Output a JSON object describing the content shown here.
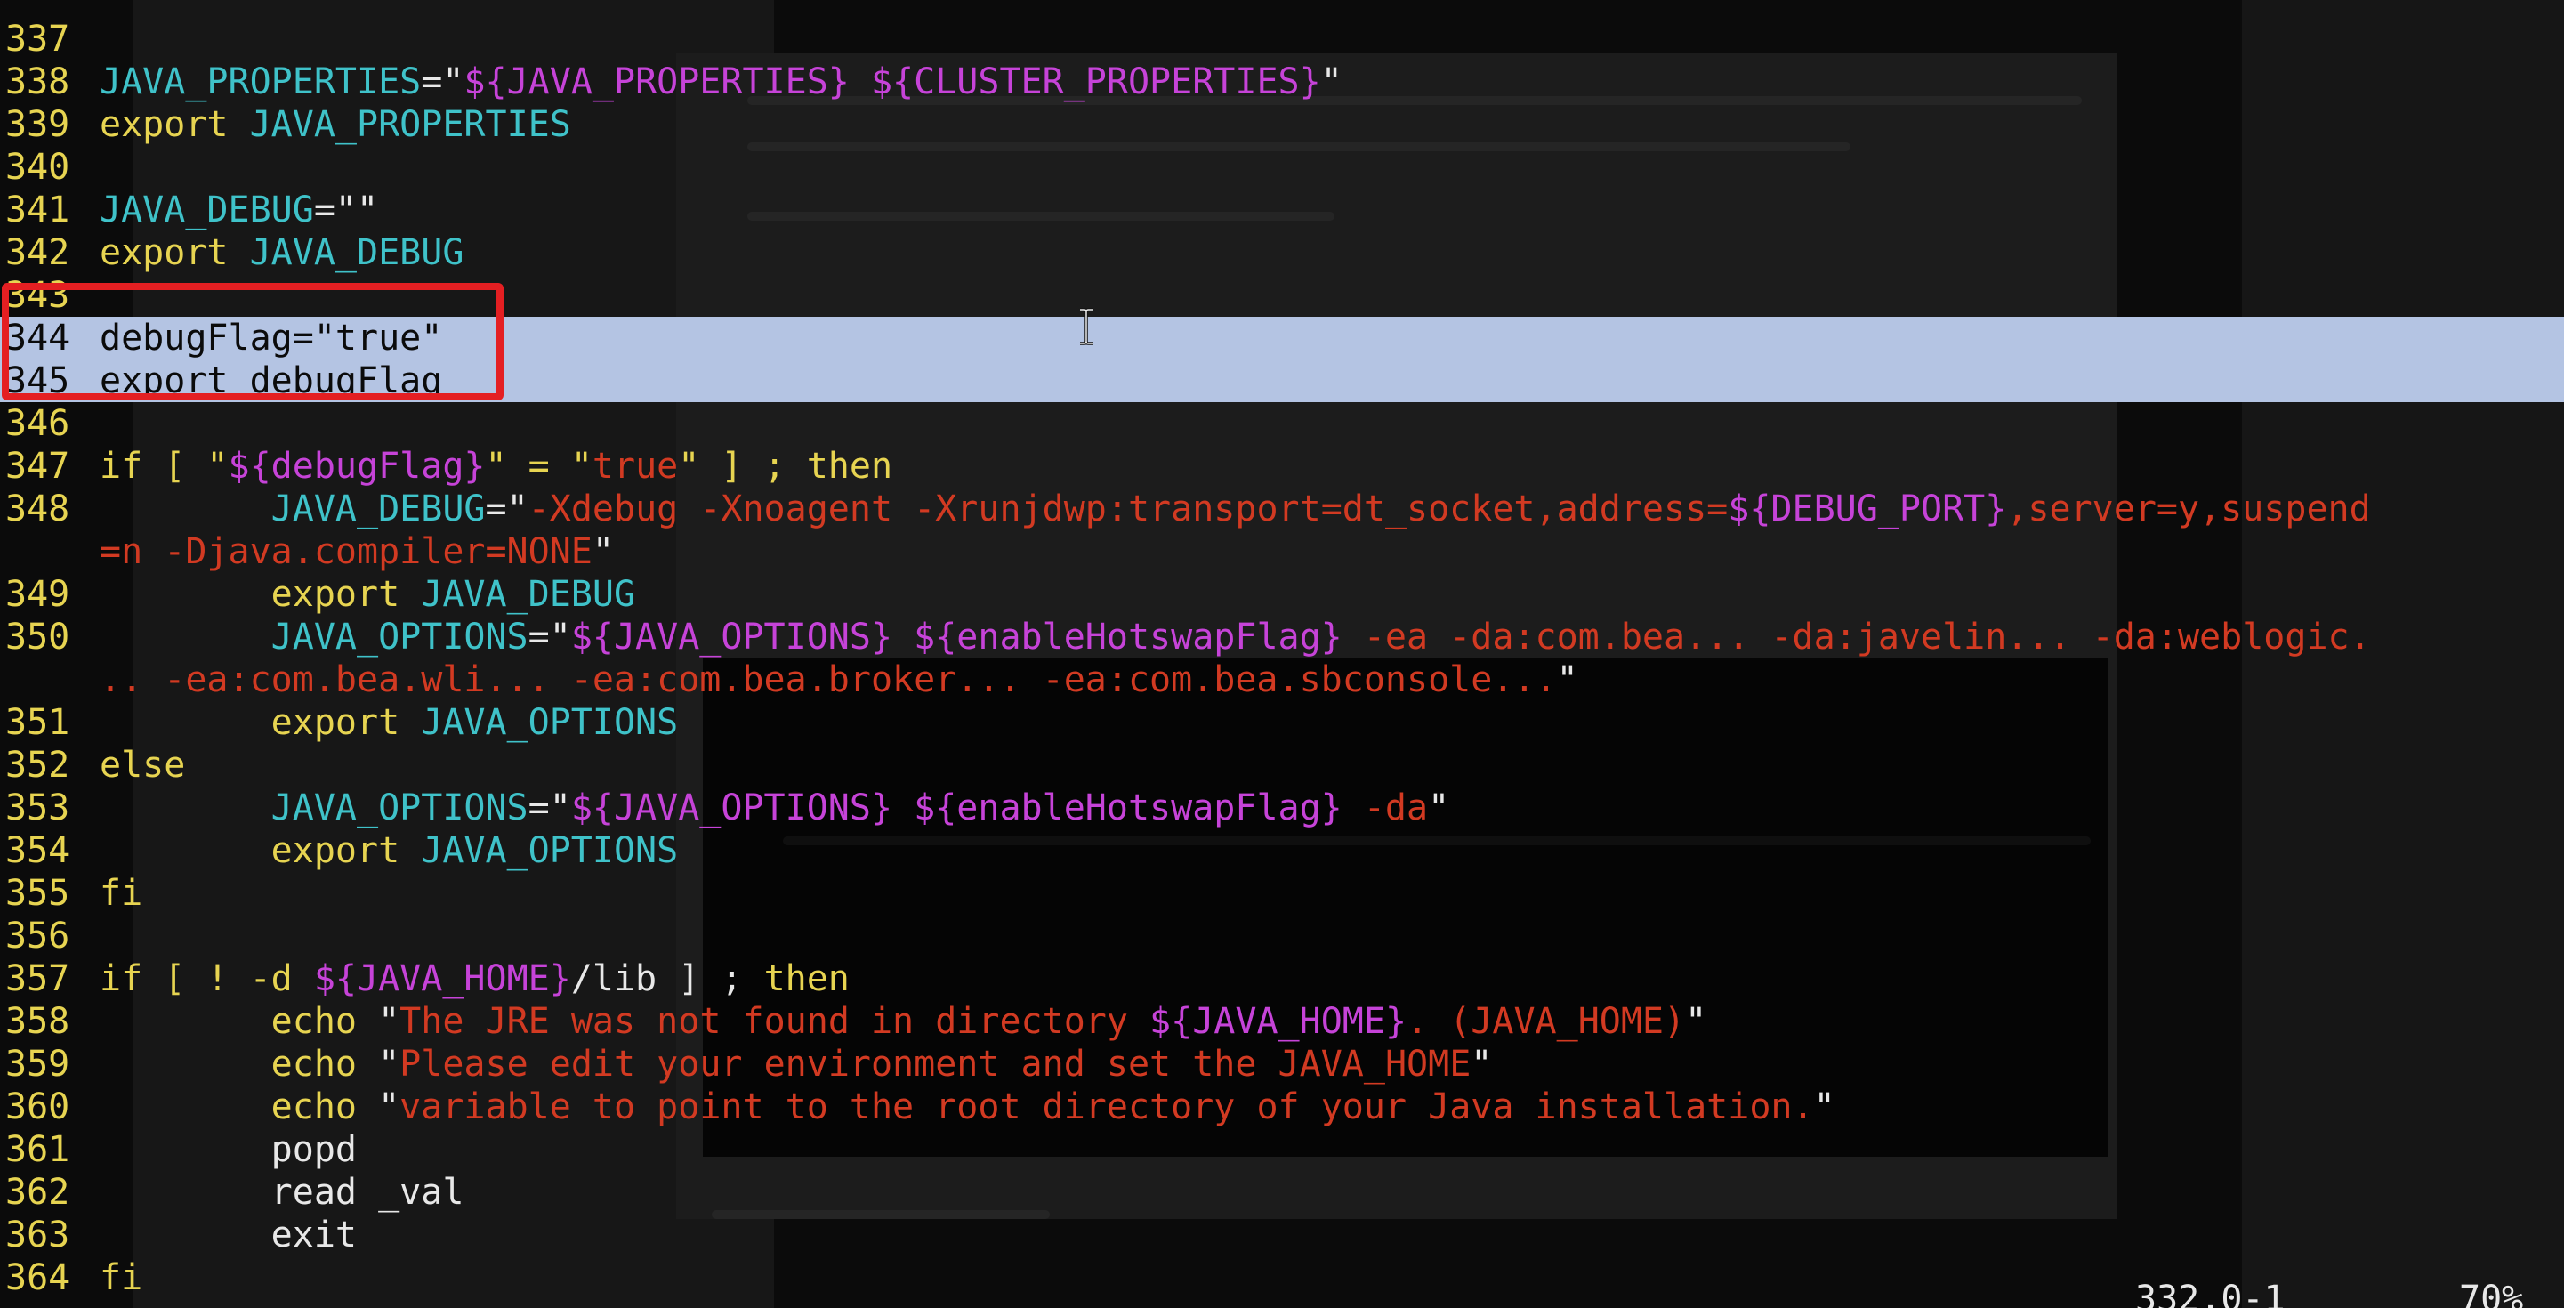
{
  "editor": {
    "lines": [
      {
        "num": "337",
        "tokens": []
      },
      {
        "num": "338",
        "tokens": [
          {
            "t": "JAVA_PROPERTIES",
            "c": "var"
          },
          {
            "t": "=\"",
            "c": "op"
          },
          {
            "t": "${JAVA_PROPERTIES} ${CLUSTER_PROPERTIES}",
            "c": "exp"
          },
          {
            "t": "\"",
            "c": "op"
          }
        ]
      },
      {
        "num": "339",
        "tokens": [
          {
            "t": "export ",
            "c": "kw"
          },
          {
            "t": "JAVA_PROPERTIES",
            "c": "var"
          }
        ]
      },
      {
        "num": "340",
        "tokens": []
      },
      {
        "num": "341",
        "tokens": [
          {
            "t": "JAVA_DEBUG",
            "c": "var"
          },
          {
            "t": "=\"\"",
            "c": "op"
          }
        ]
      },
      {
        "num": "342",
        "tokens": [
          {
            "t": "export ",
            "c": "kw"
          },
          {
            "t": "JAVA_DEBUG",
            "c": "var"
          }
        ]
      },
      {
        "num": "343",
        "tokens": []
      },
      {
        "num": "344",
        "highlight": true,
        "tokens": [
          {
            "t": "debugFlag=\"true\"",
            "c": "plain"
          }
        ]
      },
      {
        "num": "345",
        "highlight": true,
        "tokens": [
          {
            "t": "export debugFlag",
            "c": "plain"
          }
        ]
      },
      {
        "num": "346",
        "tokens": []
      },
      {
        "num": "347",
        "tokens": [
          {
            "t": "if [ \"",
            "c": "kw"
          },
          {
            "t": "${debugFlag}",
            "c": "exp"
          },
          {
            "t": "\" = \"",
            "c": "kw"
          },
          {
            "t": "true",
            "c": "str"
          },
          {
            "t": "\" ] ; then",
            "c": "kw"
          }
        ]
      },
      {
        "num": "348",
        "tokens": [
          {
            "t": "        JAVA_DEBUG",
            "c": "var"
          },
          {
            "t": "=\"",
            "c": "op"
          },
          {
            "t": "-Xdebug -Xnoagent -Xrunjdwp:transport=dt_socket,address=",
            "c": "str"
          },
          {
            "t": "${DEBUG_PORT}",
            "c": "exp"
          },
          {
            "t": ",server=y,suspend",
            "c": "str"
          }
        ]
      },
      {
        "num": "",
        "tokens": [
          {
            "t": "=n -Djava.compiler=NONE",
            "c": "str"
          },
          {
            "t": "\"",
            "c": "op"
          }
        ]
      },
      {
        "num": "349",
        "tokens": [
          {
            "t": "        export ",
            "c": "kw"
          },
          {
            "t": "JAVA_DEBUG",
            "c": "var"
          }
        ]
      },
      {
        "num": "350",
        "tokens": [
          {
            "t": "        JAVA_OPTIONS",
            "c": "var"
          },
          {
            "t": "=\"",
            "c": "op"
          },
          {
            "t": "${JAVA_OPTIONS} ${enableHotswapFlag}",
            "c": "exp"
          },
          {
            "t": " -ea -da:com.bea... -da:javelin... -da:weblogic.",
            "c": "str"
          }
        ]
      },
      {
        "num": "",
        "tokens": [
          {
            "t": ".. -ea:com.bea.wli... -ea:com.bea.broker... -ea:com.bea.sbconsole...",
            "c": "str"
          },
          {
            "t": "\"",
            "c": "op"
          }
        ]
      },
      {
        "num": "351",
        "tokens": [
          {
            "t": "        export ",
            "c": "kw"
          },
          {
            "t": "JAVA_OPTIONS",
            "c": "var"
          }
        ]
      },
      {
        "num": "352",
        "tokens": [
          {
            "t": "else",
            "c": "kw"
          }
        ]
      },
      {
        "num": "353",
        "tokens": [
          {
            "t": "        JAVA_OPTIONS",
            "c": "var"
          },
          {
            "t": "=\"",
            "c": "op"
          },
          {
            "t": "${JAVA_OPTIONS} ${enableHotswapFlag}",
            "c": "exp"
          },
          {
            "t": " -da",
            "c": "str"
          },
          {
            "t": "\"",
            "c": "op"
          }
        ]
      },
      {
        "num": "354",
        "tokens": [
          {
            "t": "        export ",
            "c": "kw"
          },
          {
            "t": "JAVA_OPTIONS",
            "c": "var"
          }
        ]
      },
      {
        "num": "355",
        "tokens": [
          {
            "t": "fi",
            "c": "kw"
          }
        ]
      },
      {
        "num": "356",
        "tokens": []
      },
      {
        "num": "357",
        "tokens": [
          {
            "t": "if [ ! -d ",
            "c": "kw"
          },
          {
            "t": "${JAVA_HOME}",
            "c": "exp"
          },
          {
            "t": "/lib ] ; ",
            "c": "plain"
          },
          {
            "t": "then",
            "c": "kw"
          }
        ]
      },
      {
        "num": "358",
        "tokens": [
          {
            "t": "        echo ",
            "c": "kw"
          },
          {
            "t": "\"",
            "c": "op"
          },
          {
            "t": "The JRE was not found in directory ",
            "c": "str"
          },
          {
            "t": "${JAVA_HOME}",
            "c": "exp"
          },
          {
            "t": ". (JAVA_HOME)",
            "c": "str"
          },
          {
            "t": "\"",
            "c": "op"
          }
        ]
      },
      {
        "num": "359",
        "tokens": [
          {
            "t": "        echo ",
            "c": "kw"
          },
          {
            "t": "\"",
            "c": "op"
          },
          {
            "t": "Please edit your environment and set the JAVA_HOME",
            "c": "str"
          },
          {
            "t": "\"",
            "c": "op"
          }
        ]
      },
      {
        "num": "360",
        "tokens": [
          {
            "t": "        echo ",
            "c": "kw"
          },
          {
            "t": "\"",
            "c": "op"
          },
          {
            "t": "variable to point to the root directory of your Java installation.",
            "c": "str"
          },
          {
            "t": "\"",
            "c": "op"
          }
        ]
      },
      {
        "num": "361",
        "tokens": [
          {
            "t": "        popd",
            "c": "plain"
          }
        ]
      },
      {
        "num": "362",
        "tokens": [
          {
            "t": "        read _val",
            "c": "plain"
          }
        ]
      },
      {
        "num": "363",
        "tokens": [
          {
            "t": "        exit",
            "c": "plain"
          }
        ]
      },
      {
        "num": "364",
        "tokens": [
          {
            "t": "fi",
            "c": "kw"
          }
        ]
      }
    ]
  },
  "status": {
    "position": "332,0-1",
    "percent": "70%"
  },
  "colors": {
    "line_number": "#e7d451",
    "variable": "#3fc2c9",
    "string": "#d23a22",
    "expansion": "#c643d8",
    "highlight": "#b4c4e3",
    "annotation_box": "#e41f22"
  },
  "icons": {
    "text_cursor": "i-beam-cursor-icon"
  }
}
